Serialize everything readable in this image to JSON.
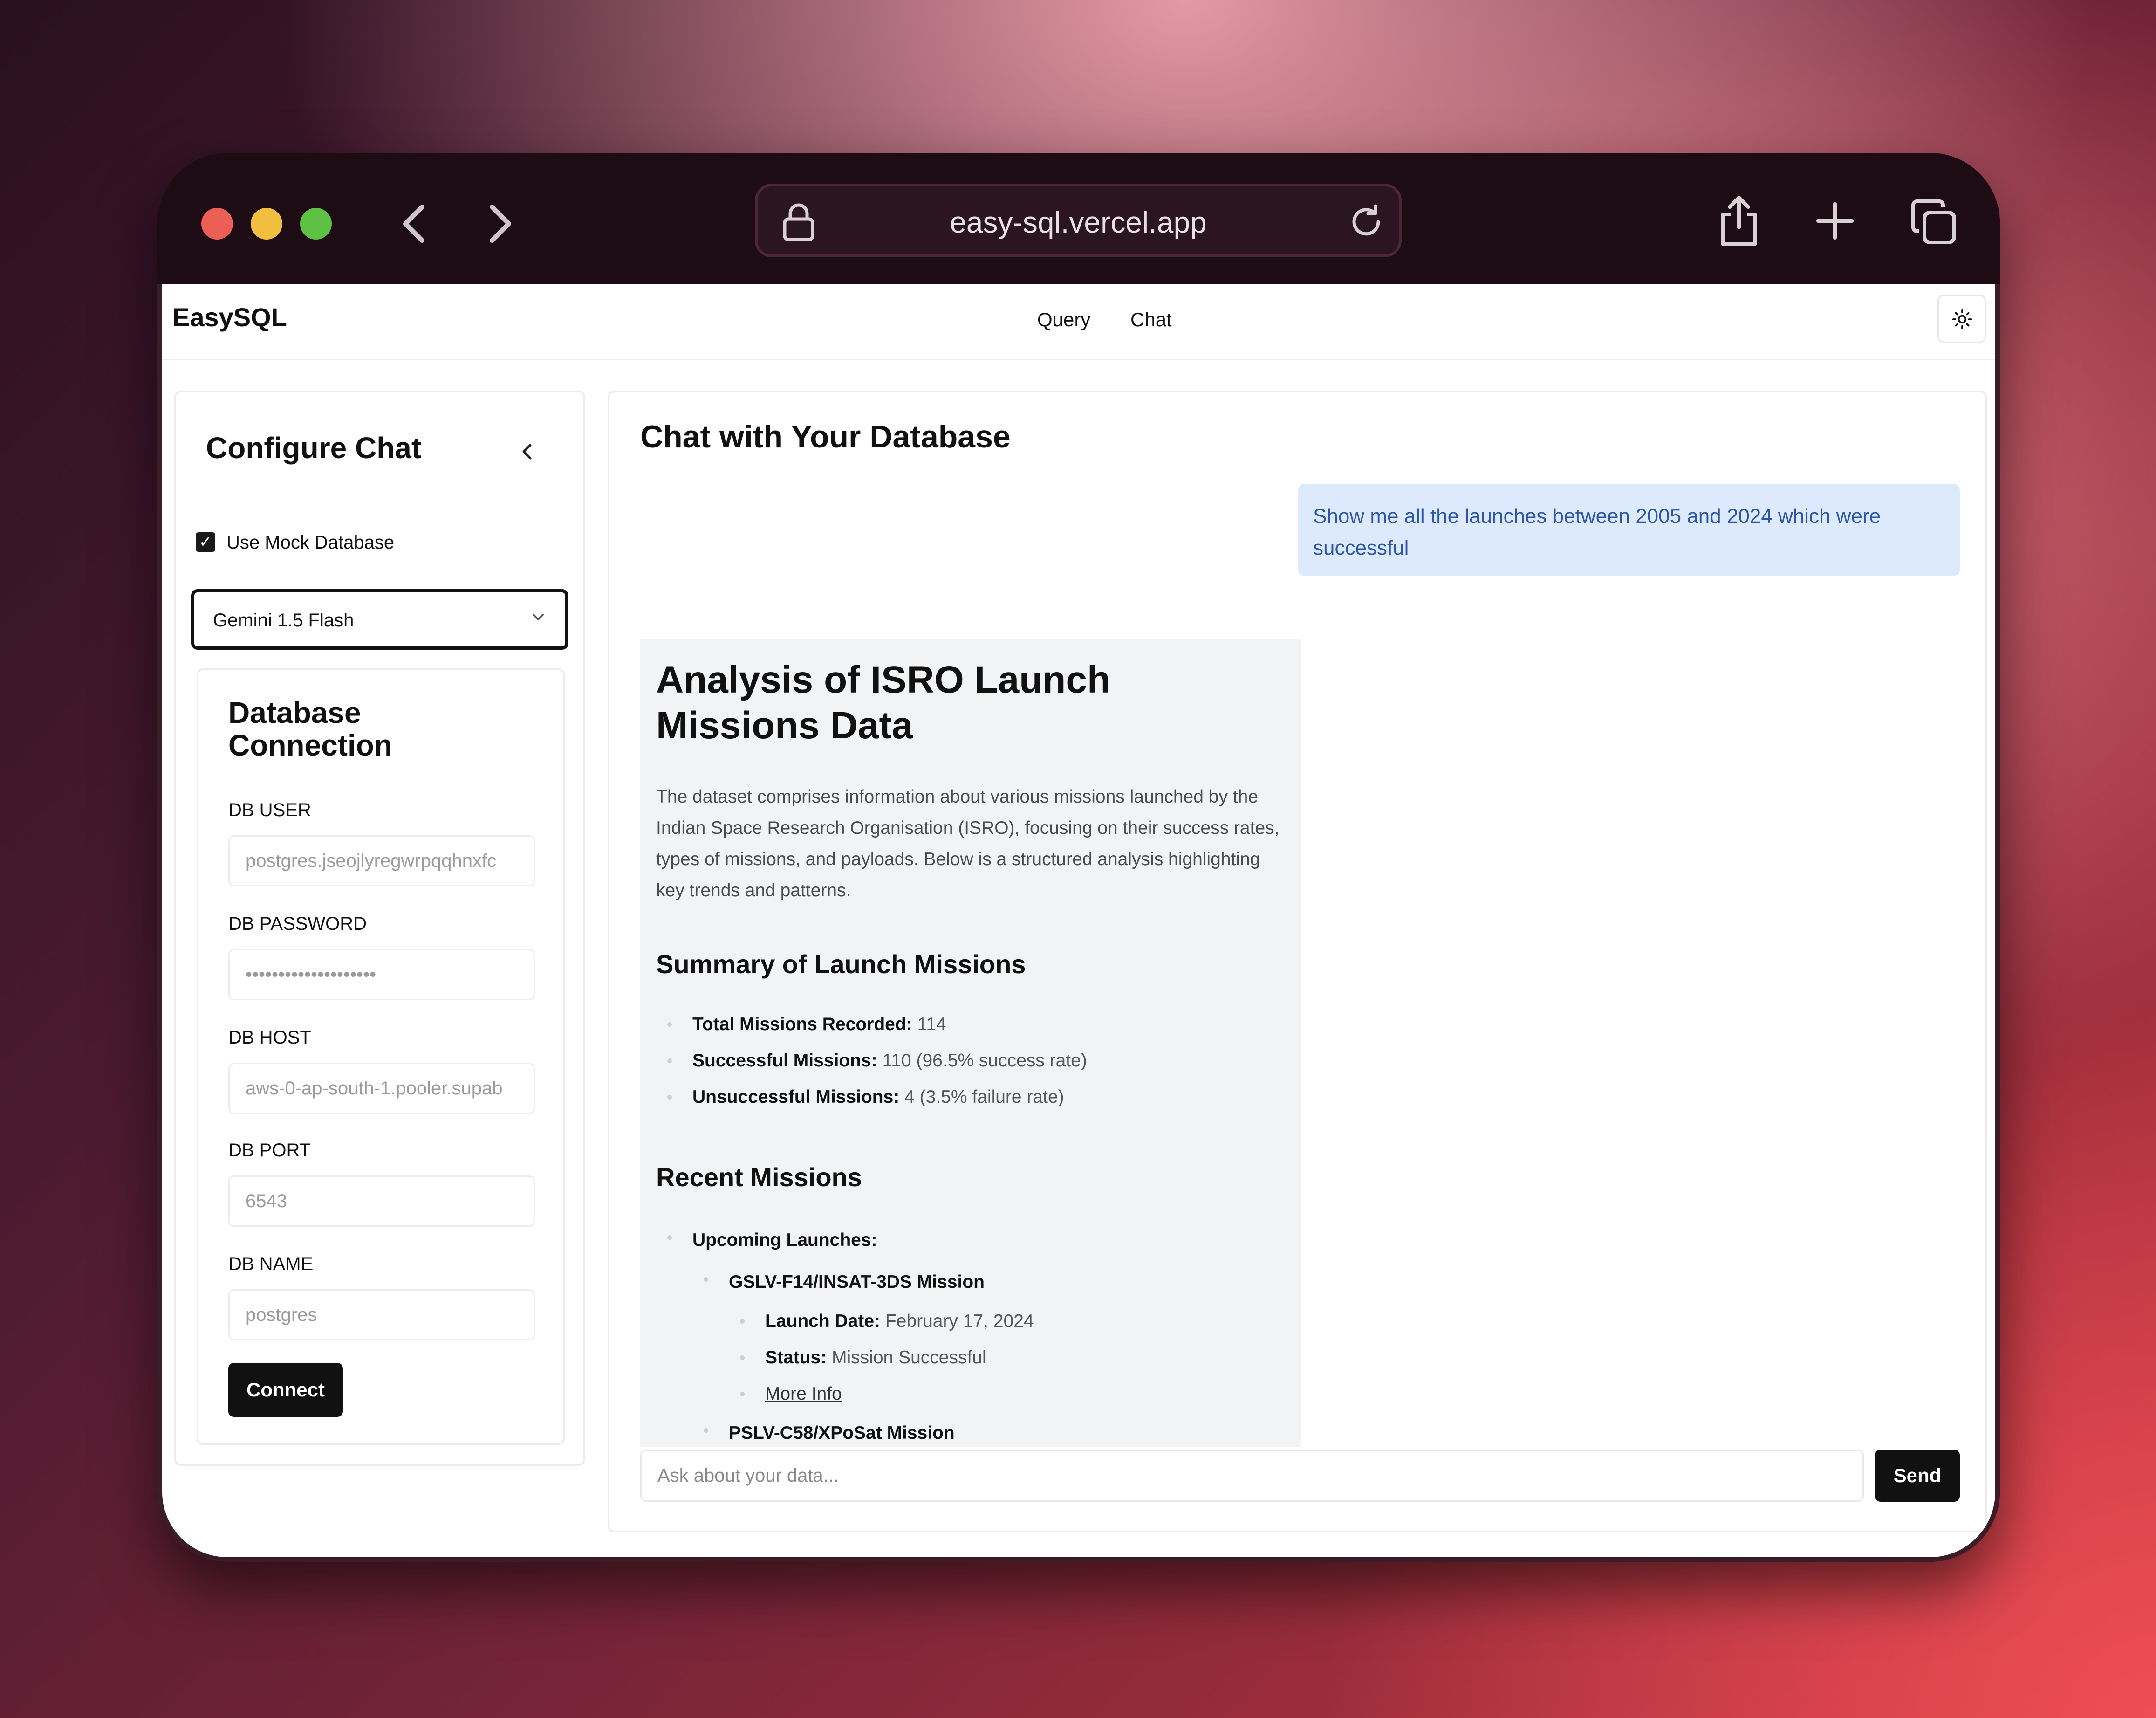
{
  "browser": {
    "url": "easy-sql.vercel.app",
    "traffic_light_colors": [
      "#ec5f56",
      "#f1be3f",
      "#5fc144"
    ]
  },
  "app": {
    "brand": "EasySQL",
    "nav": [
      "Query",
      "Chat"
    ]
  },
  "sidebar": {
    "title": "Configure Chat",
    "use_mock_label": "Use Mock Database",
    "use_mock_checked": true,
    "model_selected": "Gemini 1.5 Flash",
    "db_card": {
      "title": "Database Connection",
      "fields": [
        {
          "label": "DB USER",
          "value": "postgres.jseojlyregwrpqqhnxfc"
        },
        {
          "label": "DB PASSWORD",
          "value": "••••••••••••••••••••"
        },
        {
          "label": "DB HOST",
          "value": "aws-0-ap-south-1.pooler.supab"
        },
        {
          "label": "DB PORT",
          "value": "6543"
        },
        {
          "label": "DB NAME",
          "value": "postgres"
        }
      ],
      "connect_label": "Connect"
    }
  },
  "chat": {
    "title": "Chat with Your Database",
    "user_message": "Show me all the launches between 2005 and 2024 which were successful",
    "answer": {
      "heading": "Analysis of ISRO Launch Missions Data",
      "intro": "The dataset comprises information about various missions launched by the Indian Space Research Organisation (ISRO), focusing on their success rates, types of missions, and payloads. Below is a structured analysis highlighting key trends and patterns.",
      "summary_heading": "Summary of Launch Missions",
      "summary": [
        {
          "label": "Total Missions Recorded:",
          "value": "114"
        },
        {
          "label": "Successful Missions:",
          "value": "110 (96.5% success rate)"
        },
        {
          "label": "Unsuccessful Missions:",
          "value": "4 (3.5% failure rate)"
        }
      ],
      "recent_heading": "Recent Missions",
      "upcoming_label": "Upcoming Launches:",
      "missions": [
        {
          "name": "GSLV-F14/INSAT-3DS Mission",
          "launch_date_label": "Launch Date:",
          "launch_date": "February 17, 2024",
          "status_label": "Status:",
          "status": "Mission Successful",
          "more_info": "More Info"
        },
        {
          "name": "PSLV-C58/XPoSat Mission"
        }
      ]
    },
    "input_placeholder": "Ask about your data...",
    "send_label": "Send"
  }
}
